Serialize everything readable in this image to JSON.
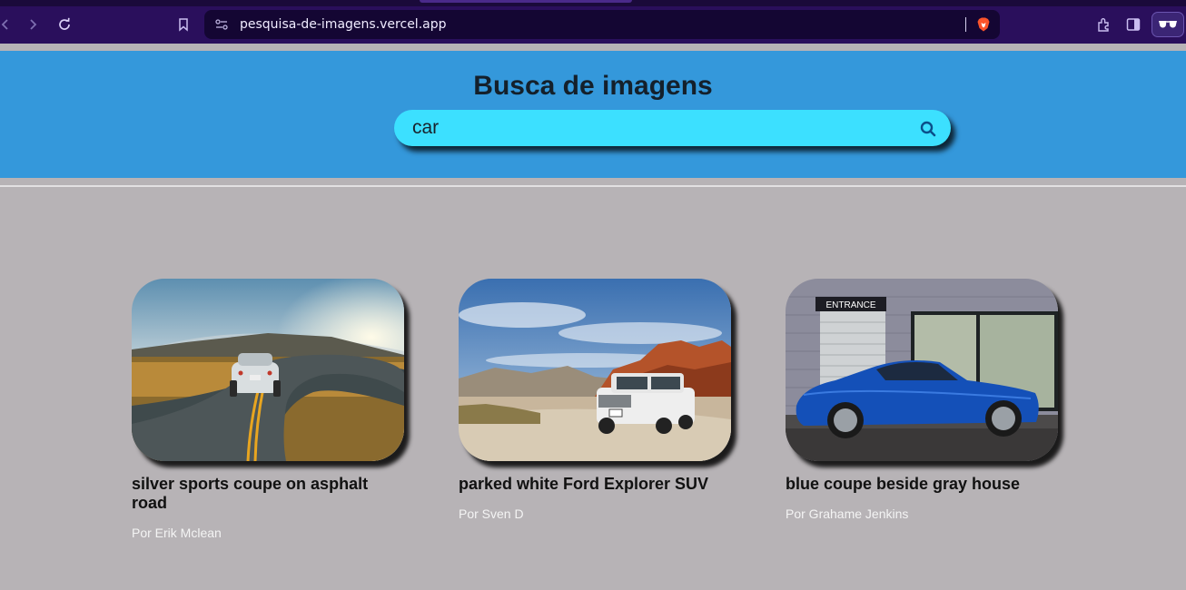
{
  "browser": {
    "url": "pesquisa-de-imagens.vercel.app",
    "icons": [
      "back-icon",
      "forward-icon",
      "reload-icon",
      "bookmark-icon",
      "site-settings-icon",
      "brave-shield-icon",
      "extensions-icon",
      "sidebar-icon",
      "profile-icon"
    ]
  },
  "header": {
    "title": "Busca de imagens",
    "search_value": "car",
    "background": "#3498db",
    "search_background": "#3ce0ff"
  },
  "results": [
    {
      "title": "silver sports coupe on asphalt road",
      "author": "Por Erik Mclean",
      "image": "silver-sports-car-on-road"
    },
    {
      "title": "parked white Ford Explorer SUV",
      "author": "Por Sven D",
      "image": "white-suv-in-desert"
    },
    {
      "title": "blue coupe beside gray house",
      "author": "Por Grahame Jenkins",
      "image": "blue-coupe-beside-house",
      "sign_text": "ENTRANCE"
    }
  ]
}
